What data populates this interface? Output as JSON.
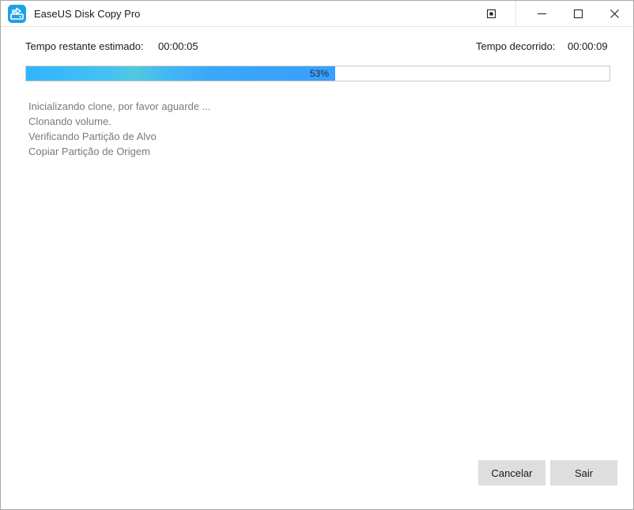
{
  "window": {
    "title": "EaseUS Disk Copy Pro",
    "controls": [
      "restore-box-icon",
      "minimize-icon",
      "maximize-icon",
      "close-icon"
    ]
  },
  "progress": {
    "remaining_label": "Tempo restante estimado:",
    "remaining_value": "00:00:05",
    "elapsed_label": "Tempo decorrido:",
    "elapsed_value": "00:00:09",
    "percent_text": "53%",
    "percent": 53
  },
  "log": {
    "lines": [
      "Inicializando clone, por favor aguarde ...",
      "Clonando volume.",
      "Verificando Partição de Alvo",
      "Copiar Partição de Origem"
    ]
  },
  "buttons": {
    "cancel_label": "Cancelar",
    "exit_label": "Sair"
  },
  "colors": {
    "accent": "#3aa0ff",
    "app_icon": "#1ea0ea",
    "button_bg": "#dedede",
    "log_text": "#7a7a7a"
  }
}
